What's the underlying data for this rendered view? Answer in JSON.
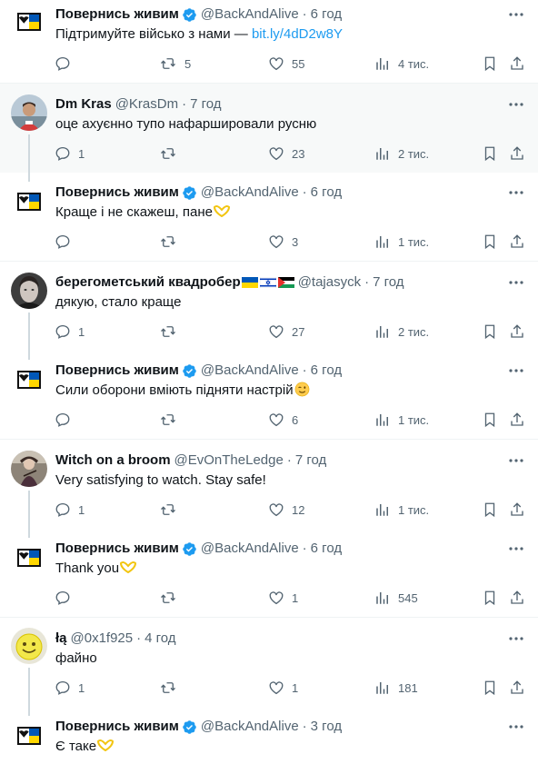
{
  "colors": {
    "accent": "#1d9bf0",
    "muted": "#536471",
    "text": "#0f1419",
    "highlight_bg": "#f7f9f9",
    "ua_blue": "#0057b7",
    "ua_yellow": "#ffd700"
  },
  "tweets": [
    {
      "name": "Повернись живим",
      "verified": true,
      "handle": "@BackAndAlive",
      "time": "6 год",
      "text": "Підтримуйте військо з нами — ",
      "link": "bit.ly/4dD2w8Y",
      "replies": "",
      "retweets": "5",
      "likes": "55",
      "views": "4 тис.",
      "avatar": "ua-logo"
    },
    {
      "name": "Dm Kras",
      "verified": false,
      "handle": "@KrasDm",
      "time": "7 год",
      "text": "оце ахуєнно тупо нафаршировали русню",
      "replies": "1",
      "retweets": "",
      "likes": "23",
      "views": "2 тис.",
      "avatar": "photo"
    },
    {
      "name": "Повернись живим",
      "verified": true,
      "handle": "@BackAndAlive",
      "time": "6 год",
      "text": "Краще і не скажеш, пане",
      "emoji": "yellow-heart-hands",
      "replies": "",
      "retweets": "",
      "likes": "3",
      "views": "1 тис.",
      "avatar": "ua-logo"
    },
    {
      "name": "берегометський квадробер",
      "verified": false,
      "flags": [
        "ukraine-flag",
        "israel-flag",
        "palestine-flag"
      ],
      "handle": "@tajasyck",
      "time": "7 год",
      "text": "дякую, стало краще",
      "replies": "1",
      "retweets": "",
      "likes": "27",
      "views": "2 тис.",
      "avatar": "photo"
    },
    {
      "name": "Повернись живим",
      "verified": true,
      "handle": "@BackAndAlive",
      "time": "6 год",
      "text": "Сили оборони вміють підняти настрій",
      "emoji": "wink-face",
      "replies": "",
      "retweets": "",
      "likes": "6",
      "views": "1 тис.",
      "avatar": "ua-logo"
    },
    {
      "name": "Witch on a broom",
      "verified": false,
      "handle": "@EvOnTheLedge",
      "time": "7 год",
      "text": "Very satisfying to watch. Stay safe!",
      "replies": "1",
      "retweets": "",
      "likes": "12",
      "views": "1 тис.",
      "avatar": "photo"
    },
    {
      "name": "Повернись живим",
      "verified": true,
      "handle": "@BackAndAlive",
      "time": "6 год",
      "text": "Thank you",
      "emoji": "yellow-heart-hands",
      "replies": "",
      "retweets": "",
      "likes": "1",
      "views": "545",
      "avatar": "ua-logo"
    },
    {
      "name": "łą",
      "verified": false,
      "handle": "@0x1f925",
      "time": "4 год",
      "text": "файно",
      "replies": "1",
      "retweets": "",
      "likes": "1",
      "views": "181",
      "avatar": "smiley"
    },
    {
      "name": "Повернись живим",
      "verified": true,
      "handle": "@BackAndAlive",
      "time": "3 год",
      "text": "Є таке",
      "emoji": "yellow-heart-hands",
      "avatar": "ua-logo"
    }
  ]
}
